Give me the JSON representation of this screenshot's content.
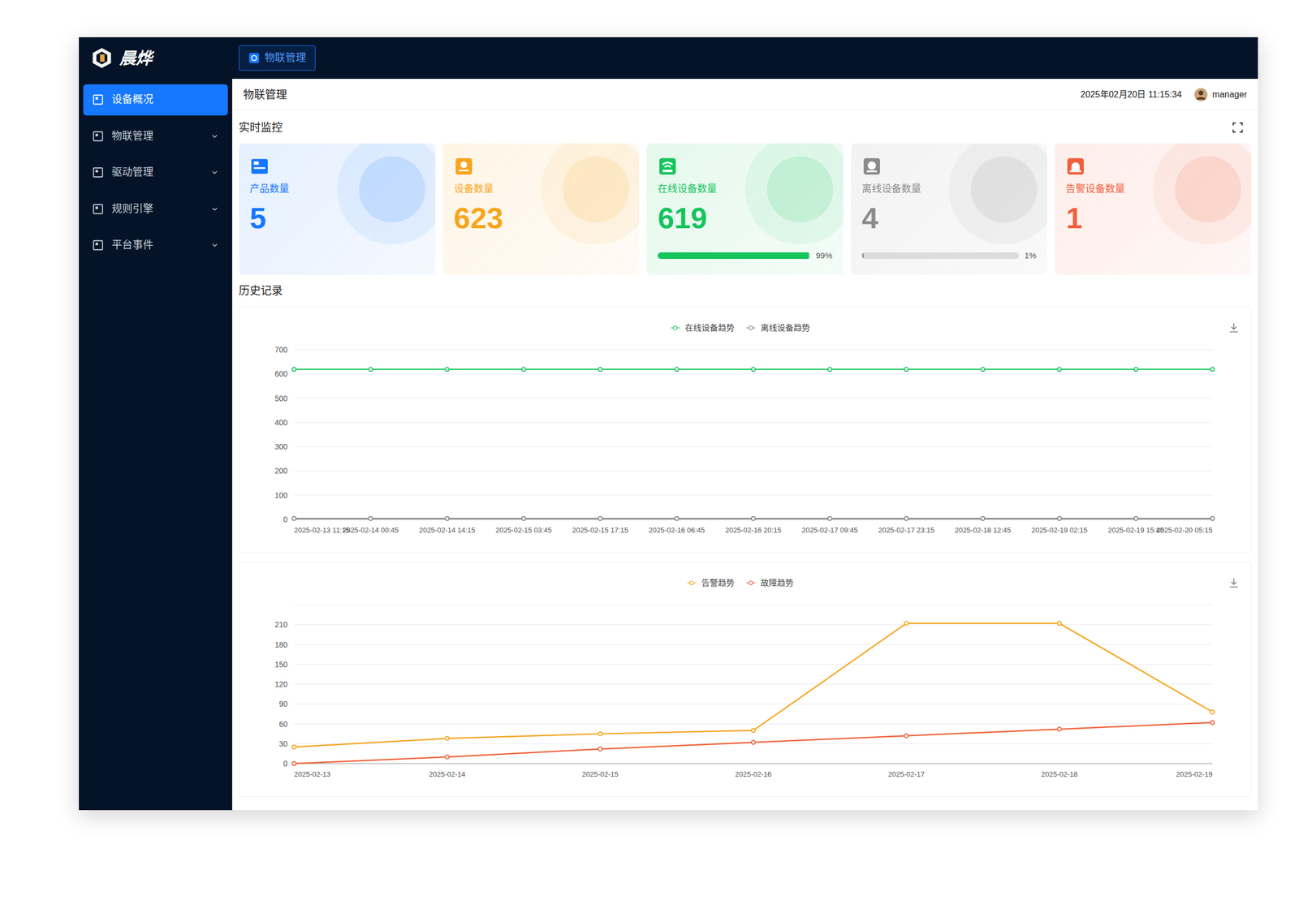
{
  "brand": {
    "name": "晨烨"
  },
  "top_tabs": [
    {
      "label": "物联管理",
      "selected": true
    }
  ],
  "sidebar": {
    "items": [
      {
        "label": "设备概况",
        "kind": "link",
        "selected": true
      },
      {
        "label": "物联管理",
        "kind": "group",
        "selected": false
      },
      {
        "label": "驱动管理",
        "kind": "group",
        "selected": false
      },
      {
        "label": "规则引擎",
        "kind": "group",
        "selected": false
      },
      {
        "label": "平台事件",
        "kind": "group",
        "selected": false
      }
    ]
  },
  "header": {
    "title": "物联管理",
    "datetime": "2025年02月20日 11:15:34",
    "user": "manager"
  },
  "realtime": {
    "title": "实时监控",
    "cards": [
      {
        "label": "产品数量",
        "value": "5",
        "color": "#1677ff",
        "kind": "plain"
      },
      {
        "label": "设备数量",
        "value": "623",
        "color": "#f7a51c",
        "kind": "plain"
      },
      {
        "label": "在线设备数量",
        "value": "619",
        "color": "#16c45c",
        "kind": "progress",
        "level": 0.99,
        "reading": "99%"
      },
      {
        "label": "离线设备数量",
        "value": "4",
        "color": "#8c8c8c",
        "kind": "progress",
        "level": 0.01,
        "reading": "1%"
      },
      {
        "label": "告警设备数量",
        "value": "1",
        "color": "#f0603c",
        "kind": "plain"
      }
    ]
  },
  "history": {
    "title": "历史记录",
    "charts": [
      {
        "y_ticks": [
          "0",
          "100",
          "200",
          "300",
          "400",
          "500",
          "600",
          "700"
        ],
        "x_labels": [
          "2025-02-13 11:15",
          "2025-02-14 00:45",
          "2025-02-14 14:15",
          "2025-02-15 03:45",
          "2025-02-15 17:15",
          "2025-02-16 06:45",
          "2025-02-16 20:15",
          "2025-02-17 09:45",
          "2025-02-17 23:15",
          "2025-02-18 12:45",
          "2025-02-19 02:15",
          "2025-02-19 15:45",
          "2025-02-20 05:15"
        ],
        "series": [
          {
            "label": "在线设备趋势",
            "color": "#1fc964",
            "values": [
              619,
              619,
              619,
              619,
              619,
              619,
              619,
              619,
              619,
              619,
              619,
              619,
              619
            ]
          },
          {
            "label": "离线设备趋势",
            "color": "#8c8c8c",
            "values": [
              4,
              4,
              4,
              4,
              4,
              4,
              4,
              4,
              4,
              4,
              4,
              4,
              4
            ]
          }
        ]
      },
      {
        "y_ticks": [
          "0",
          "30",
          "60",
          "90",
          "120",
          "150",
          "180",
          "210"
        ],
        "x_labels": [
          "2025-02-13",
          "2025-02-14",
          "2025-02-15",
          "2025-02-16",
          "2025-02-17",
          "2025-02-18",
          "2025-02-19"
        ],
        "series": [
          {
            "label": "告警趋势",
            "color": "#f5a623",
            "values": [
              25,
              38,
              45,
              50,
              212,
              212,
              78
            ]
          },
          {
            "label": "故障趋势",
            "color": "#f0643c",
            "values": [
              0,
              10,
              22,
              32,
              42,
              52,
              62
            ]
          }
        ]
      }
    ]
  }
}
